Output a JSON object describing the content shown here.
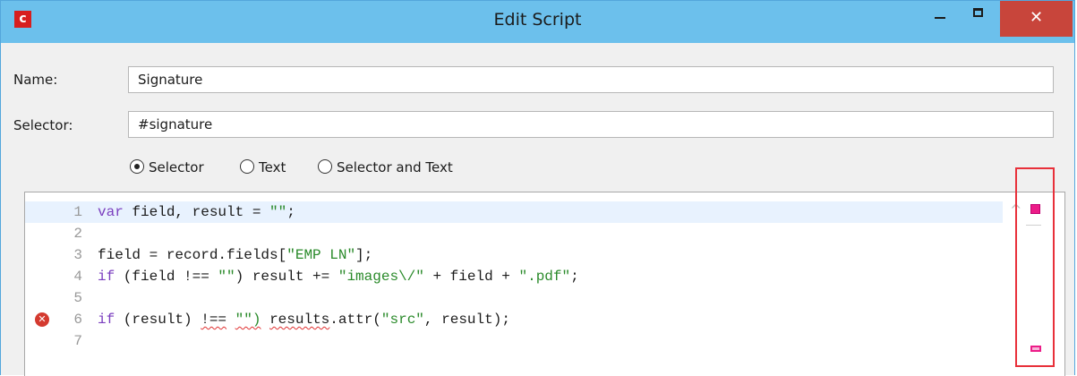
{
  "window": {
    "app_icon_letter": "c",
    "title": "Edit Script",
    "close_glyph": "✕"
  },
  "form": {
    "name_label": "Name:",
    "name_value": "Signature",
    "selector_label": "Selector:",
    "selector_value": "#signature",
    "radios": [
      {
        "label": "Selector",
        "selected": true
      },
      {
        "label": "Text",
        "selected": false
      },
      {
        "label": "Selector and Text",
        "selected": false
      }
    ]
  },
  "editor": {
    "lines": [
      {
        "num": "1",
        "active": true,
        "error": false,
        "tokens": [
          [
            "kw",
            "var"
          ],
          [
            "plain",
            " field, result = "
          ],
          [
            "str",
            "\"\""
          ],
          [
            "plain",
            ";"
          ]
        ]
      },
      {
        "num": "2",
        "active": false,
        "error": false,
        "tokens": []
      },
      {
        "num": "3",
        "active": false,
        "error": false,
        "tokens": [
          [
            "plain",
            "field = record.fields["
          ],
          [
            "str",
            "\"EMP LN\""
          ],
          [
            "plain",
            "];"
          ]
        ]
      },
      {
        "num": "4",
        "active": false,
        "error": false,
        "tokens": [
          [
            "kw",
            "if"
          ],
          [
            "plain",
            " (field !== "
          ],
          [
            "str",
            "\"\""
          ],
          [
            "plain",
            ") result += "
          ],
          [
            "str",
            "\"images\\/\""
          ],
          [
            "plain",
            " + field + "
          ],
          [
            "str",
            "\".pdf\""
          ],
          [
            "plain",
            ";"
          ]
        ]
      },
      {
        "num": "5",
        "active": false,
        "error": false,
        "tokens": []
      },
      {
        "num": "6",
        "active": false,
        "error": true,
        "tokens": [
          [
            "kw",
            "if"
          ],
          [
            "plain",
            " (result) "
          ],
          [
            "plain-squig",
            "!=="
          ],
          [
            "plain",
            " "
          ],
          [
            "str-squig",
            "\"\")"
          ],
          [
            "plain",
            " "
          ],
          [
            "plain-squig",
            "results"
          ],
          [
            "plain",
            ".attr("
          ],
          [
            "str",
            "\"src\""
          ],
          [
            "plain",
            ", result);"
          ]
        ]
      },
      {
        "num": "7",
        "active": false,
        "error": false,
        "tokens": []
      }
    ],
    "error_icon": "error-icon",
    "ruler": {
      "collapse_glyph": "^",
      "marker_color": "#ec1c88",
      "highlight_color": "#e8303a"
    }
  }
}
